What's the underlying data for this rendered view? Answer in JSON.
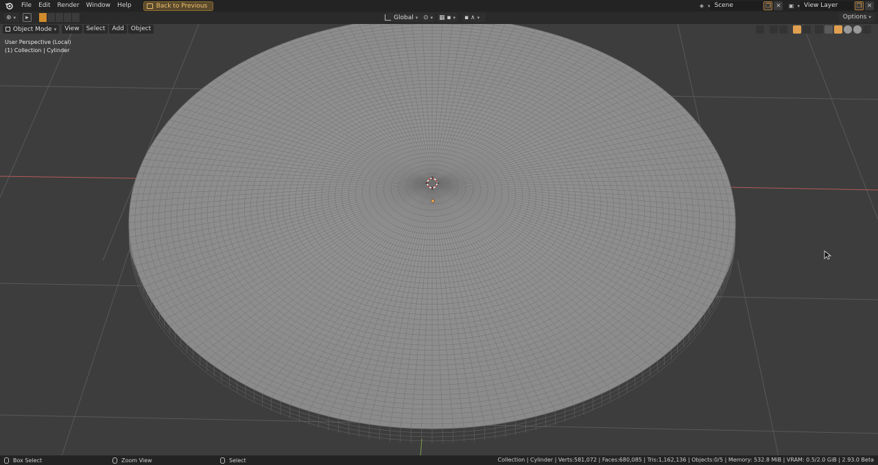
{
  "menubar": {
    "items": [
      "File",
      "Edit",
      "Render",
      "Window",
      "Help"
    ],
    "back_label": "Back to Previous",
    "scene": "Scene",
    "view_layer": "View Layer"
  },
  "toolheader": {
    "orientation": "Global",
    "options": "Options"
  },
  "viewport_header": {
    "mode": "Object Mode",
    "menus": [
      "View",
      "Select",
      "Add",
      "Object"
    ]
  },
  "overlay": {
    "perspective": "User Perspective (Local)",
    "collection": "(1) Collection | Cylinder"
  },
  "statusbar": {
    "hint_left": "Box Select",
    "hint_middle": "Zoom View",
    "hint_right": "Select",
    "stats": "Collection | Cylinder | Verts:581,072 | Faces:680,085 | Tris:1,162,136 | Objects:0/5 | Memory: 532.8 MiB | VRAM: 0.5/2.0 GiB | 2.93.0 Beta"
  },
  "colors": {
    "background": "#3d3d3d",
    "grid": "#5a5a5a",
    "x_axis": "#b85b5b",
    "y_axis": "#7fa04a",
    "mesh": "#8f8f8f",
    "accent": "#e0a050"
  },
  "icons": [
    "blender-logo-icon",
    "cursor-tool-icon",
    "transform-orientation-icon",
    "pivot-icon",
    "snap-icon",
    "proportional-icon",
    "scene-icon",
    "view-layer-icon",
    "viewport-shading-icon",
    "mouse-icon"
  ]
}
